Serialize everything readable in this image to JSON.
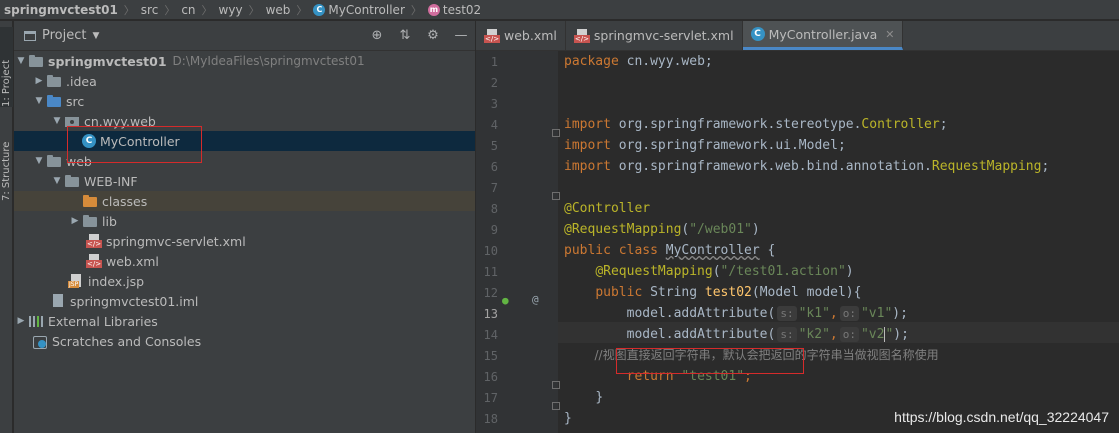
{
  "breadcrumb": {
    "items": [
      "springmvctest01",
      "src",
      "cn",
      "wyy",
      "web",
      "MyController",
      "test02"
    ]
  },
  "left_strip": {
    "project_tab": "1: Project",
    "structure_tab": "7: Structure"
  },
  "project_panel": {
    "title": "Project",
    "tree": [
      {
        "label": "springmvctest01",
        "path": "D:\\MyIdeaFiles\\springmvctest01"
      },
      {
        "label": ".idea"
      },
      {
        "label": "src"
      },
      {
        "label": "cn.wyy.web"
      },
      {
        "label": "MyController"
      },
      {
        "label": "web"
      },
      {
        "label": "WEB-INF"
      },
      {
        "label": "classes"
      },
      {
        "label": "lib"
      },
      {
        "label": "springmvc-servlet.xml"
      },
      {
        "label": "web.xml"
      },
      {
        "label": "index.jsp"
      },
      {
        "label": "springmvctest01.iml"
      },
      {
        "label": "External Libraries"
      },
      {
        "label": "Scratches and Consoles"
      }
    ]
  },
  "editor": {
    "tabs": [
      {
        "label": "web.xml"
      },
      {
        "label": "springmvc-servlet.xml"
      },
      {
        "label": "MyController.java"
      }
    ],
    "line_numbers": [
      "1",
      "2",
      "3",
      "4",
      "5",
      "6",
      "7",
      "8",
      "9",
      "10",
      "11",
      "12",
      "13",
      "14",
      "15",
      "16",
      "17",
      "18"
    ],
    "code": {
      "l1_kw": "package",
      "l1_rest": " cn.wyy.web;",
      "l3_kw": "import",
      "l3_a": " org.springframework.stereotype.",
      "l3_b": "Controller",
      "l3_c": ";",
      "l4_kw": "import",
      "l4_a": " org.springframework.ui.Model;",
      "l5_kw": "import",
      "l5_a": " org.springframework.web.bind.annotation.",
      "l5_b": "RequestMapping",
      "l5_c": ";",
      "l7": "@Controller",
      "l8_an": "@RequestMapping",
      "l8_a": "(",
      "l8_s": "\"/web01\"",
      "l8_b": ")",
      "l9_kw": "public class ",
      "l9_name": "MyController",
      "l9_rest": " {",
      "l10_an": "@RequestMapping",
      "l10_a": "(",
      "l10_s": "\"/test01.action\"",
      "l10_b": ")",
      "l11_kw": "public ",
      "l11_a": "String ",
      "l11_fn": "test02",
      "l11_b": "(Model model){",
      "l12_a": "model.addAttribute(",
      "l12_h1": "s:",
      "l12_s1": "\"k1\"",
      "l12_c": ",",
      "l12_h2": "o:",
      "l12_s2": "\"v1\"",
      "l12_d": ");",
      "l13_a": "model.addAttribute(",
      "l13_h1": "s:",
      "l13_s1": "\"k2\"",
      "l13_c": ",",
      "l13_h2": "o:",
      "l13_s2a": "\"v2",
      "l13_s2b": "\"",
      "l13_d": ");",
      "l14": "//视图直接返回字符串，默认会把返回的字符串当做视图名称使用",
      "l15_kw": "return",
      "l15_s": " \"test01\"",
      "l15_c": ";",
      "l16": "}",
      "l17": "}"
    },
    "gutter_at": "@"
  },
  "watermark": "https://blog.csdn.net/qq_32224047",
  "colors": {
    "background": "#2b2b2b",
    "panel": "#3c3f41",
    "selection": "#0d293e",
    "keyword": "#cc7832",
    "annotation": "#bbb529",
    "string": "#6a8759",
    "function": "#ffc66d",
    "highlight_box": "#d52b2b"
  }
}
